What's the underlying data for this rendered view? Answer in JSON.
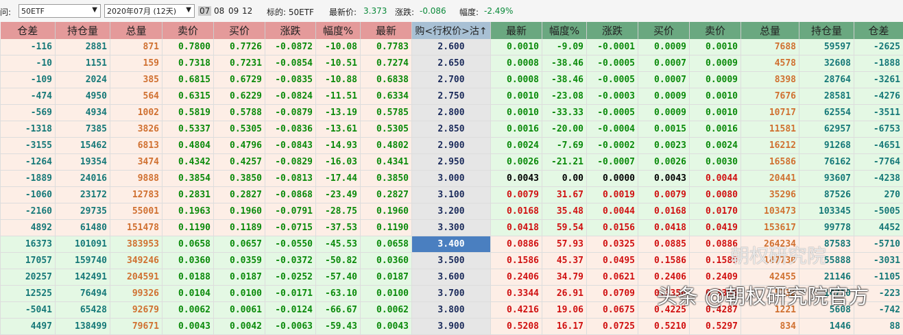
{
  "toolbar": {
    "label_prefix": "问:",
    "underlying_select": "50ETF",
    "month_select": "2020年07月 (12天)",
    "months": [
      "07",
      "08",
      "09",
      "12"
    ],
    "underlying_label": "标的: 50ETF",
    "last_label": "最新价:",
    "last_value": "3.373",
    "change_label": "涨跌:",
    "change_value": "-0.086",
    "pct_label": "幅度:",
    "pct_value": "-2.49%"
  },
  "headers": {
    "call": [
      "仓差",
      "持仓量",
      "总量",
      "卖价",
      "买价",
      "涨跌",
      "幅度%",
      "最新"
    ],
    "strike": "购<行权价>沽↑",
    "put": [
      "最新",
      "幅度%",
      "涨跌",
      "买价",
      "卖价",
      "总量",
      "持仓量",
      "仓差"
    ]
  },
  "rows": [
    {
      "strike": "2.600",
      "call": [
        "-116",
        "2881",
        "871",
        "0.7800",
        "0.7726",
        "-0.0872",
        "-10.08",
        "0.7783"
      ],
      "put": [
        "0.0010",
        "-9.09",
        "-0.0001",
        "0.0009",
        "0.0010",
        "7688",
        "59597",
        "-2625"
      ]
    },
    {
      "strike": "2.650",
      "call": [
        "-10",
        "1151",
        "159",
        "0.7318",
        "0.7231",
        "-0.0854",
        "-10.51",
        "0.7274"
      ],
      "put": [
        "0.0008",
        "-38.46",
        "-0.0005",
        "0.0007",
        "0.0009",
        "4578",
        "32608",
        "-1888"
      ]
    },
    {
      "strike": "2.700",
      "call": [
        "-109",
        "2024",
        "385",
        "0.6815",
        "0.6729",
        "-0.0835",
        "-10.88",
        "0.6838"
      ],
      "put": [
        "0.0008",
        "-38.46",
        "-0.0005",
        "0.0007",
        "0.0009",
        "8398",
        "28764",
        "-3261"
      ]
    },
    {
      "strike": "2.750",
      "call": [
        "-474",
        "4950",
        "564",
        "0.6315",
        "0.6229",
        "-0.0824",
        "-11.51",
        "0.6334"
      ],
      "put": [
        "0.0010",
        "-23.08",
        "-0.0003",
        "0.0009",
        "0.0010",
        "7676",
        "28581",
        "-4276"
      ]
    },
    {
      "strike": "2.800",
      "call": [
        "-569",
        "4934",
        "1002",
        "0.5819",
        "0.5788",
        "-0.0879",
        "-13.19",
        "0.5785"
      ],
      "put": [
        "0.0010",
        "-33.33",
        "-0.0005",
        "0.0009",
        "0.0010",
        "10717",
        "62554",
        "-3511"
      ]
    },
    {
      "strike": "2.850",
      "call": [
        "-1318",
        "7385",
        "3826",
        "0.5337",
        "0.5305",
        "-0.0836",
        "-13.61",
        "0.5305"
      ],
      "put": [
        "0.0016",
        "-20.00",
        "-0.0004",
        "0.0015",
        "0.0016",
        "11581",
        "62957",
        "-6753"
      ]
    },
    {
      "strike": "2.900",
      "call": [
        "-3155",
        "15462",
        "6813",
        "0.4804",
        "0.4796",
        "-0.0843",
        "-14.93",
        "0.4802"
      ],
      "put": [
        "0.0024",
        "-7.69",
        "-0.0002",
        "0.0023",
        "0.0024",
        "16212",
        "91268",
        "-4651"
      ]
    },
    {
      "strike": "2.950",
      "call": [
        "-1264",
        "19354",
        "3474",
        "0.4342",
        "0.4257",
        "-0.0829",
        "-16.03",
        "0.4341"
      ],
      "put": [
        "0.0026",
        "-21.21",
        "-0.0007",
        "0.0026",
        "0.0030",
        "16586",
        "76162",
        "-7764"
      ]
    },
    {
      "strike": "3.000",
      "call": [
        "-1889",
        "24016",
        "9888",
        "0.3854",
        "0.3850",
        "-0.0813",
        "-17.44",
        "0.3850"
      ],
      "put": [
        "0.0043",
        "0.00",
        "0.0000",
        "0.0043",
        "0.0044",
        "20441",
        "93607",
        "-4238"
      ]
    },
    {
      "strike": "3.100",
      "call": [
        "-1060",
        "23172",
        "12783",
        "0.2831",
        "0.2827",
        "-0.0868",
        "-23.49",
        "0.2827"
      ],
      "put": [
        "0.0079",
        "31.67",
        "0.0019",
        "0.0079",
        "0.0080",
        "35296",
        "87526",
        "270"
      ]
    },
    {
      "strike": "3.200",
      "call": [
        "-2160",
        "29735",
        "55001",
        "0.1963",
        "0.1960",
        "-0.0791",
        "-28.75",
        "0.1960"
      ],
      "put": [
        "0.0168",
        "35.48",
        "0.0044",
        "0.0168",
        "0.0170",
        "103473",
        "103345",
        "-5005"
      ]
    },
    {
      "strike": "3.300",
      "call": [
        "4892",
        "61480",
        "151478",
        "0.1190",
        "0.1189",
        "-0.0715",
        "-37.53",
        "0.1190"
      ],
      "put": [
        "0.0418",
        "59.54",
        "0.0156",
        "0.0418",
        "0.0419",
        "153617",
        "99778",
        "4452"
      ]
    },
    {
      "strike": "3.400",
      "call": [
        "16373",
        "101091",
        "383953",
        "0.0658",
        "0.0657",
        "-0.0550",
        "-45.53",
        "0.0658"
      ],
      "put": [
        "0.0886",
        "57.93",
        "0.0325",
        "0.0885",
        "0.0886",
        "264234",
        "87583",
        "-5710"
      ]
    },
    {
      "strike": "3.500",
      "call": [
        "17057",
        "159740",
        "349246",
        "0.0360",
        "0.0359",
        "-0.0372",
        "-50.82",
        "0.0360"
      ],
      "put": [
        "0.1586",
        "45.37",
        "0.0495",
        "0.1586",
        "0.1589",
        "147730",
        "55888",
        "-3031"
      ]
    },
    {
      "strike": "3.600",
      "call": [
        "20257",
        "142491",
        "204591",
        "0.0188",
        "0.0187",
        "-0.0252",
        "-57.40",
        "0.0187"
      ],
      "put": [
        "0.2406",
        "34.79",
        "0.0621",
        "0.2406",
        "0.2409",
        "42455",
        "21146",
        "-1105"
      ]
    },
    {
      "strike": "3.700",
      "call": [
        "12525",
        "76494",
        "99326",
        "0.0104",
        "0.0100",
        "-0.0171",
        "-63.10",
        "0.0100"
      ],
      "put": [
        "0.3344",
        "26.91",
        "0.0709",
        "0.3350",
        "0.3356",
        "5332",
        "14710",
        "-223"
      ]
    },
    {
      "strike": "3.800",
      "call": [
        "-5041",
        "65428",
        "92679",
        "0.0062",
        "0.0061",
        "-0.0124",
        "-66.67",
        "0.0062"
      ],
      "put": [
        "0.4216",
        "19.06",
        "0.0675",
        "0.4225",
        "0.4287",
        "1221",
        "5608",
        "-742"
      ]
    },
    {
      "strike": "3.900",
      "call": [
        "4497",
        "138499",
        "79671",
        "0.0043",
        "0.0042",
        "-0.0063",
        "-59.43",
        "0.0043"
      ],
      "put": [
        "0.5208",
        "16.17",
        "0.0725",
        "0.5210",
        "0.5297",
        "834",
        "1446",
        "88"
      ]
    }
  ],
  "atm_strike": "3.400",
  "watermark": {
    "line1": "朝权研究院",
    "line2": "头条 @朝权研究院官方"
  }
}
